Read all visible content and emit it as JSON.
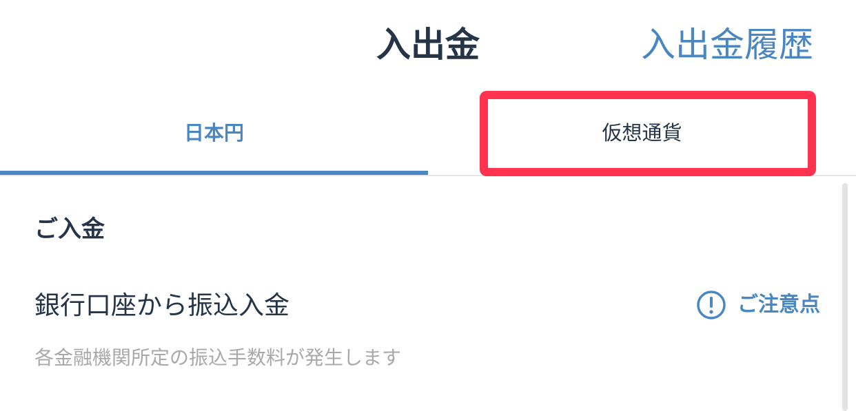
{
  "header": {
    "title": "入出金",
    "history_link": "入出金履歴"
  },
  "tabs": [
    {
      "label": "日本円",
      "active": true
    },
    {
      "label": "仮想通貨",
      "active": false
    }
  ],
  "deposit": {
    "section_title": "ご入金",
    "bank_transfer": {
      "title": "銀行口座から振込入金",
      "notice_label": "ご注意点",
      "notice_icon": "exclamation-circle-icon",
      "description": "各金融機関所定の振込手数料が発生します"
    }
  },
  "colors": {
    "accent": "#4a86c0",
    "text": "#253447",
    "muted": "#a9a9a9",
    "highlight": "#ff3250"
  }
}
